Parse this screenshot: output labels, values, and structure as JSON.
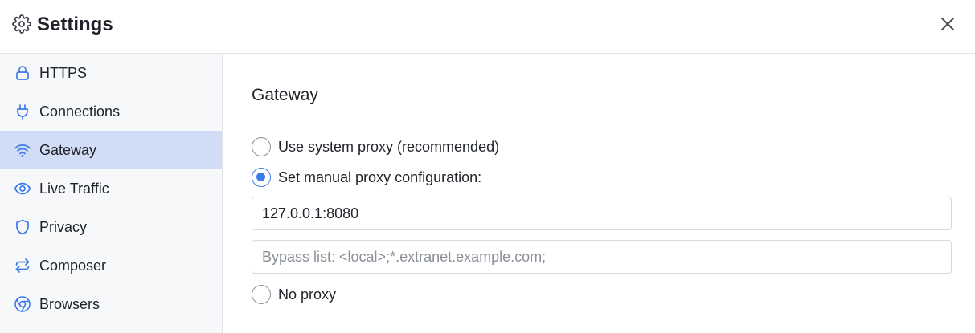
{
  "header": {
    "title": "Settings",
    "icon": "gear-icon",
    "close_icon": "close-icon"
  },
  "sidebar": {
    "items": [
      {
        "label": "HTTPS",
        "icon": "lock-icon",
        "active": false
      },
      {
        "label": "Connections",
        "icon": "plug-icon",
        "active": false
      },
      {
        "label": "Gateway",
        "icon": "wifi-icon",
        "active": true
      },
      {
        "label": "Live Traffic",
        "icon": "eye-icon",
        "active": false
      },
      {
        "label": "Privacy",
        "icon": "shield-icon",
        "active": false
      },
      {
        "label": "Composer",
        "icon": "arrows-swap-icon",
        "active": false
      },
      {
        "label": "Browsers",
        "icon": "chrome-icon",
        "active": false
      }
    ]
  },
  "main": {
    "section_title": "Gateway",
    "options": {
      "system_proxy": {
        "label": "Use system proxy (recommended)",
        "checked": false
      },
      "manual_proxy": {
        "label": "Set manual proxy configuration:",
        "checked": true
      },
      "no_proxy": {
        "label": "No proxy",
        "checked": false
      }
    },
    "proxy_field": {
      "value": "127.0.0.1:8080",
      "placeholder": ""
    },
    "bypass_field": {
      "value": "",
      "placeholder": "Bypass list: <local>;*.extranet.example.com;"
    }
  },
  "colors": {
    "accent": "#3e7bea",
    "active_item_bg": "#d1ddf6",
    "sidebar_bg": "#f7f8fa",
    "border": "#e1e3e8"
  }
}
